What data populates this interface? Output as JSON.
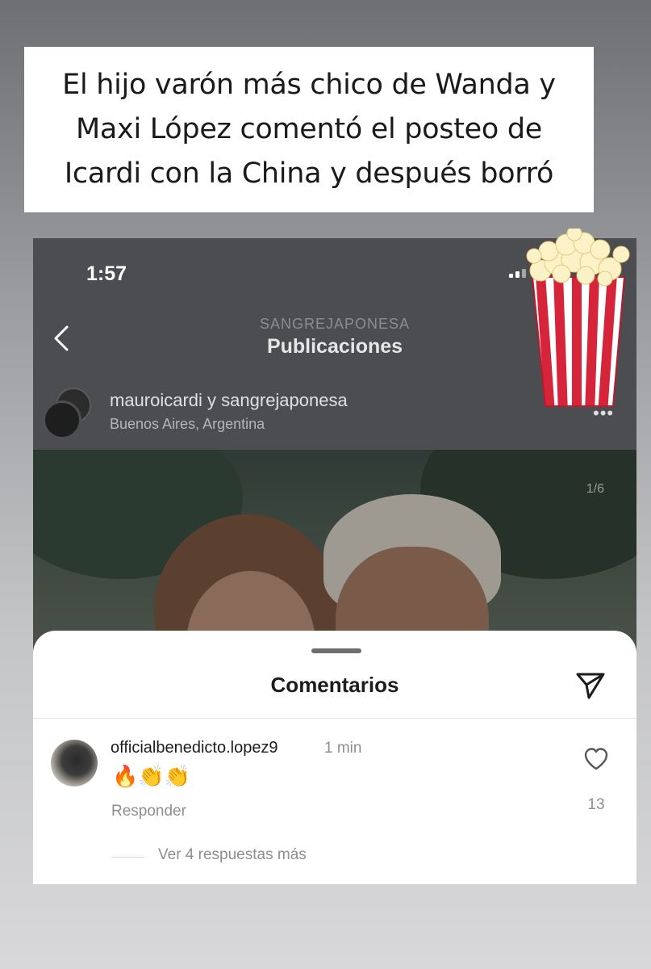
{
  "caption": {
    "lines": [
      "El hijo varón más chico de Wanda y",
      "Maxi López comentó el posteo de",
      "Icardi con la China y después borró"
    ]
  },
  "status_bar": {
    "time": "1:57"
  },
  "nav": {
    "subtitle": "SANGREJAPONESA",
    "title": "Publicaciones"
  },
  "post": {
    "users": "mauroicardi y sangrejaponesa",
    "location": "Buenos Aires, Argentina",
    "more": "•••",
    "page_counter": "1/6"
  },
  "comments_sheet": {
    "title": "Comentarios",
    "comment": {
      "username": "officialbenedicto.lopez9",
      "time": "1 min",
      "text": "🔥👏👏",
      "reply_label": "Responder",
      "like_count": "13",
      "more_replies": "Ver 4 respuestas más"
    }
  },
  "icons": [
    "chevron-left-icon",
    "more-icon",
    "send-icon",
    "heart-icon",
    "popcorn-sticker"
  ]
}
